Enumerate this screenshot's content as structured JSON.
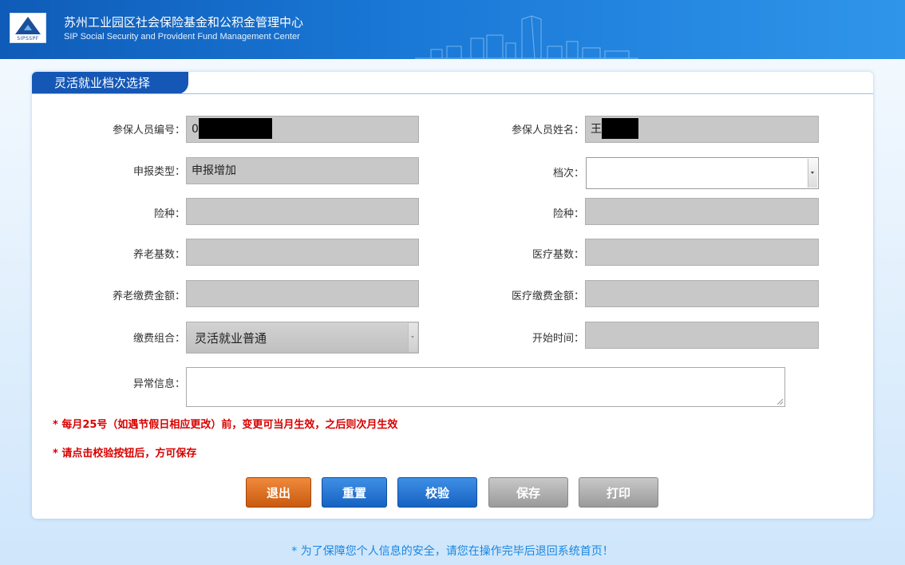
{
  "header": {
    "title_cn": "苏州工业园区社会保险基金和公积金管理中心",
    "title_en": "SIP Social Security and Provident Fund Management Center",
    "logo_text": "SIPSSPF"
  },
  "panel": {
    "title": "灵活就业档次选择"
  },
  "form": {
    "member_id_label": "参保人员编号：",
    "member_id_value": "0",
    "member_name_label": "参保人员姓名：",
    "member_name_value": "王",
    "report_type_label": "申报类型：",
    "report_type_value": "申报增加",
    "grade_label": "档次：",
    "grade_value": "",
    "insurance_label_1": "险种：",
    "insurance_value_1": "",
    "insurance_label_2": "险种：",
    "insurance_value_2": "",
    "pension_base_label": "养老基数：",
    "pension_base_value": "",
    "medical_base_label": "医疗基数：",
    "medical_base_value": "",
    "pension_amount_label": "养老缴费金额：",
    "pension_amount_value": "",
    "medical_amount_label": "医疗缴费金额：",
    "medical_amount_value": "",
    "combo_label": "缴费组合：",
    "combo_value": "灵活就业普通",
    "start_time_label": "开始时间：",
    "start_time_value": "",
    "exception_label": "异常信息：",
    "exception_value": ""
  },
  "notes": {
    "note1": "* 每月25号（如遇节假日相应更改）前，变更可当月生效，之后则次月生效",
    "note2": "* 请点击校验按钮后，方可保存"
  },
  "buttons": {
    "exit": "退出",
    "reset": "重置",
    "check": "校验",
    "save": "保存",
    "print": "打印"
  },
  "footer": {
    "note": "* 为了保障您个人信息的安全，请您在操作完毕后退回系统首页！"
  },
  "colors": {
    "header_blue": "#1a78d6",
    "tab_blue": "#1557b5",
    "note_red": "#d80000",
    "exit_orange": "#e0782a",
    "button_blue": "#2a77d4",
    "disabled_gray": "#b0b0b0",
    "footer_blue": "#1a86e0"
  }
}
